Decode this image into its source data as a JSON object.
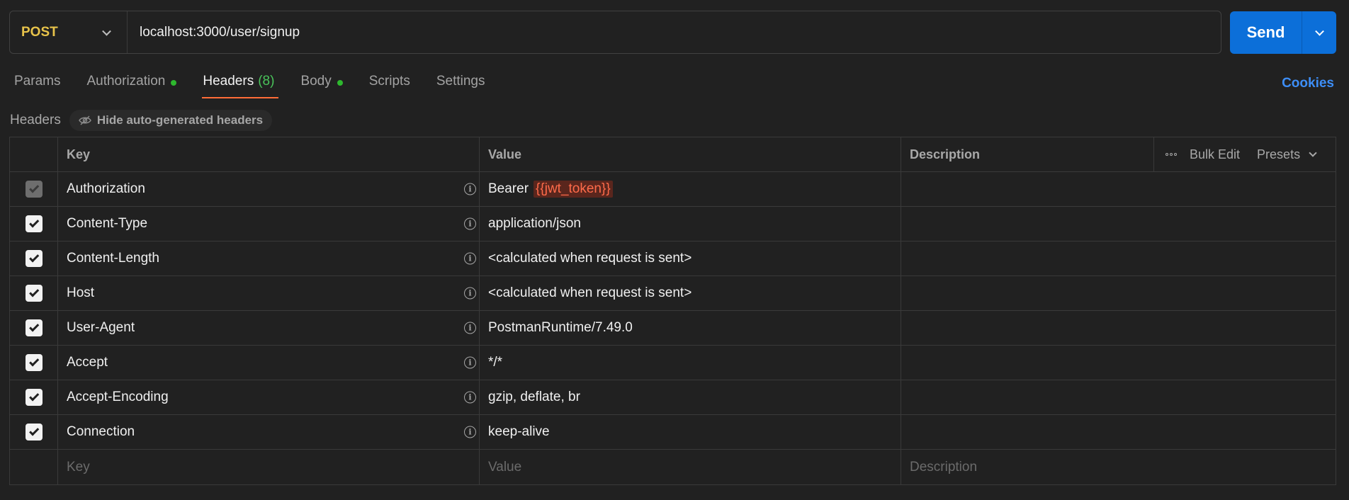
{
  "request": {
    "method": "POST",
    "url": "localhost:3000/user/signup",
    "send_label": "Send"
  },
  "tabs": [
    {
      "label": "Params",
      "dot": false,
      "count": ""
    },
    {
      "label": "Authorization",
      "dot": true,
      "count": ""
    },
    {
      "label": "Headers",
      "dot": false,
      "count": "(8)"
    },
    {
      "label": "Body",
      "dot": true,
      "count": ""
    },
    {
      "label": "Scripts",
      "dot": false,
      "count": ""
    },
    {
      "label": "Settings",
      "dot": false,
      "count": ""
    }
  ],
  "active_tab": "Headers",
  "cookies_label": "Cookies",
  "headers_section": {
    "title": "Headers",
    "hide_auto_label": "Hide auto-generated headers"
  },
  "table": {
    "columns": {
      "key": "Key",
      "value": "Value",
      "description": "Description",
      "bulk_edit": "Bulk Edit",
      "presets": "Presets"
    },
    "rows": [
      {
        "key": "Authorization",
        "value_prefix": "Bearer",
        "value_var": "{{jwt_token}}",
        "checked": true,
        "disabled": true
      },
      {
        "key": "Content-Type",
        "value": "application/json",
        "checked": true,
        "disabled": false
      },
      {
        "key": "Content-Length",
        "value": "<calculated when request is sent>",
        "checked": true,
        "disabled": false
      },
      {
        "key": "Host",
        "value": "<calculated when request is sent>",
        "checked": true,
        "disabled": false
      },
      {
        "key": "User-Agent",
        "value": "PostmanRuntime/7.49.0",
        "checked": true,
        "disabled": false
      },
      {
        "key": "Accept",
        "value": "*/*",
        "checked": true,
        "disabled": false
      },
      {
        "key": "Accept-Encoding",
        "value": "gzip, deflate, br",
        "checked": true,
        "disabled": false
      },
      {
        "key": "Connection",
        "value": "keep-alive",
        "checked": true,
        "disabled": false
      }
    ],
    "new_row": {
      "key_placeholder": "Key",
      "value_placeholder": "Value",
      "description_placeholder": "Description"
    }
  },
  "colors": {
    "method": "#e8c34a",
    "send": "#0c6fd9",
    "active_underline": "#ff6c37",
    "dot": "#2eb82e",
    "count": "#49c35a",
    "link": "#3d8ef7",
    "var_token": "#ff6b4a"
  }
}
